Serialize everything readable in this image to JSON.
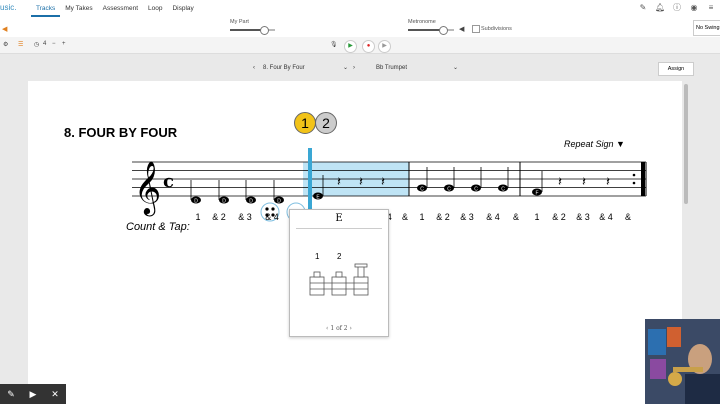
{
  "app": {
    "logo": "usic."
  },
  "nav": {
    "tabs": [
      "Tracks",
      "My Takes",
      "Assessment",
      "Loop",
      "Display"
    ],
    "active": "Tracks"
  },
  "mixer": {
    "my_part_label": "My Part",
    "my_part_level": 0.75,
    "metronome_label": "Metronome",
    "metronome_level": 0.75,
    "subdivisions_label": "Subdivisions",
    "swing_select": "No Swing"
  },
  "toolbar": {
    "measure": "4"
  },
  "selectors": {
    "piece": "8. Four By Four",
    "instrument": "Bb Trumpet",
    "assign_label": "Assign"
  },
  "score": {
    "title": "8.  FOUR BY FOUR",
    "repeat_label": "Repeat Sign ▼",
    "count_label": "Count & Tap:",
    "counts": [
      "1",
      "& 2",
      "& 3",
      "& 4",
      "&",
      "1",
      "& 2",
      "& 3",
      "& 4",
      "&",
      "1",
      "& 2",
      "& 3",
      "& 4",
      "&",
      "1",
      "& 2",
      "& 3",
      "& 4",
      "&"
    ],
    "time_signature": "c",
    "note_letters": [
      "D",
      "D",
      "D",
      "D",
      "E",
      "C",
      "C",
      "C",
      "C",
      "F"
    ],
    "take_badges": [
      "1",
      "2"
    ]
  },
  "popup": {
    "note": "E",
    "fingering_labels": [
      "1",
      "2"
    ],
    "pager": "1 of 2"
  },
  "colors": {
    "accent": "#1b6fa8",
    "highlight": "#bfe4f5",
    "cursor": "#3aa7d4",
    "badge1": "#f2c318",
    "badge2": "#cccccc"
  }
}
